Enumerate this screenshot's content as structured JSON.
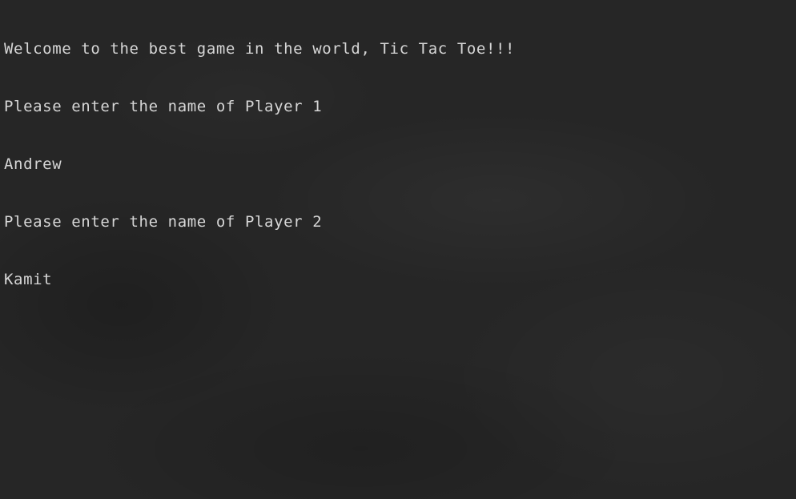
{
  "terminal": {
    "lines": [
      "Welcome to the best game in the world, Tic Tac Toe!!!",
      "Please enter the name of Player 1",
      "Andrew",
      "Please enter the name of Player 2",
      "Kamit"
    ]
  }
}
